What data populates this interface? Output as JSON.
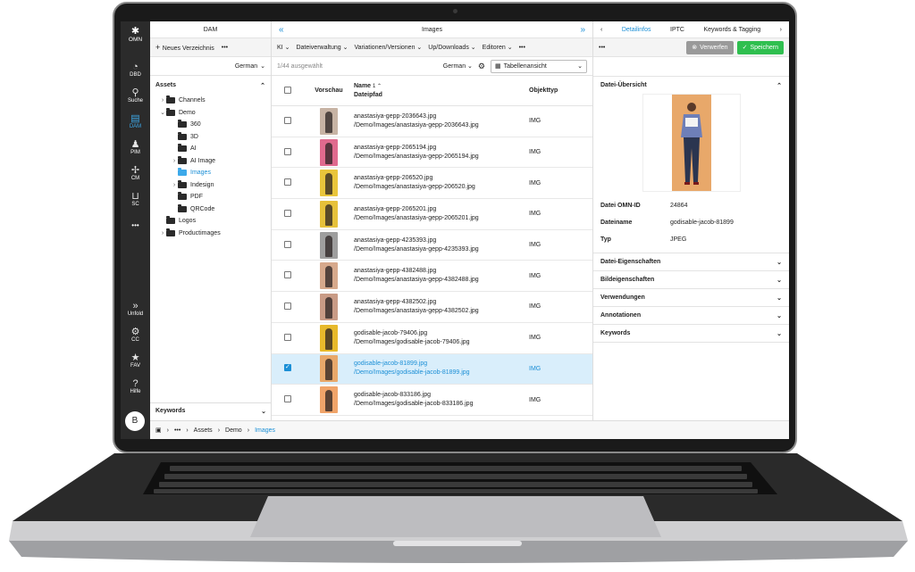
{
  "rail": {
    "logo": "OMN",
    "items": [
      {
        "label": "DBD",
        "icon": "dashboard-icon"
      },
      {
        "label": "Suche",
        "icon": "search-icon"
      },
      {
        "label": "DAM",
        "icon": "dam-icon"
      },
      {
        "label": "PIM",
        "icon": "pim-icon"
      },
      {
        "label": "CM",
        "icon": "cm-icon"
      },
      {
        "label": "SC",
        "icon": "cart-icon"
      },
      {
        "label": "Unfold",
        "icon": "unfold-icon"
      },
      {
        "label": "CC",
        "icon": "gear-icon"
      },
      {
        "label": "FAV",
        "icon": "star-icon"
      },
      {
        "label": "Hilfe",
        "icon": "help-icon"
      }
    ],
    "more": "•••",
    "avatar": "B"
  },
  "dam": {
    "title": "DAM",
    "new_dir": "Neues Verzeichnis",
    "more": "•••",
    "language": "German",
    "assets_label": "Assets",
    "tree": [
      {
        "label": "Channels",
        "chev": "›",
        "indent": 0
      },
      {
        "label": "Demo",
        "chev": "⌄",
        "indent": 0
      },
      {
        "label": "360",
        "chev": "",
        "indent": 1
      },
      {
        "label": "3D",
        "chev": "",
        "indent": 1
      },
      {
        "label": "AI",
        "chev": "",
        "indent": 1
      },
      {
        "label": "AI Image",
        "chev": "›",
        "indent": 1
      },
      {
        "label": "Images",
        "chev": "",
        "indent": 1
      },
      {
        "label": "Indesign",
        "chev": "›",
        "indent": 1
      },
      {
        "label": "PDF",
        "chev": "",
        "indent": 1
      },
      {
        "label": "QRCode",
        "chev": "",
        "indent": 1
      },
      {
        "label": "Logos",
        "chev": "",
        "indent": 0
      },
      {
        "label": "Productimages",
        "chev": "›",
        "indent": 0
      }
    ],
    "keywords": "Keywords"
  },
  "images": {
    "title": "Images",
    "menu": [
      "KI",
      "Dateiverwaltung",
      "Variationen/Versionen",
      "Up/Downloads",
      "Editoren"
    ],
    "more": "•••",
    "count": "1/44 ausgewählt",
    "language": "German",
    "view": "Tabellenansicht",
    "col_preview": "Vorschau",
    "col_name": "Name",
    "col_path": "Dateipfad",
    "sort": "1 ⌃",
    "col_type": "Objekttyp",
    "rows": [
      {
        "name": "anastasiya-gepp-2036643.jpg",
        "path": "/Demo/Images/anastasiya-gepp-2036643.jpg",
        "type": "IMG",
        "bg": "#c7b3a4",
        "checked": false
      },
      {
        "name": "anastasiya-gepp-2065194.jpg",
        "path": "/Demo/Images/anastasiya-gepp-2065194.jpg",
        "type": "IMG",
        "bg": "#e06a8e",
        "checked": false
      },
      {
        "name": "anastasiya-gepp-206520.jpg",
        "path": "/Demo/Images/anastasiya-gepp-206520.jpg",
        "type": "IMG",
        "bg": "#e9c53b",
        "checked": false
      },
      {
        "name": "anastasiya-gepp-2065201.jpg",
        "path": "/Demo/Images/anastasiya-gepp-2065201.jpg",
        "type": "IMG",
        "bg": "#e6c13a",
        "checked": false
      },
      {
        "name": "anastasiya-gepp-4235393.jpg",
        "path": "/Demo/Images/anastasiya-gepp-4235393.jpg",
        "type": "IMG",
        "bg": "#9e9e9e",
        "checked": false
      },
      {
        "name": "anastasiya-gepp-4382488.jpg",
        "path": "/Demo/Images/anastasiya-gepp-4382488.jpg",
        "type": "IMG",
        "bg": "#d7a98c",
        "checked": false
      },
      {
        "name": "anastasiya-gepp-4382502.jpg",
        "path": "/Demo/Images/anastasiya-gepp-4382502.jpg",
        "type": "IMG",
        "bg": "#c99b86",
        "checked": false
      },
      {
        "name": "godisable-jacob-79406.jpg",
        "path": "/Demo/Images/godisable-jacob-79406.jpg",
        "type": "IMG",
        "bg": "#e7b92b",
        "checked": false
      },
      {
        "name": "godisable-jacob-81899.jpg",
        "path": "/Demo/Images/godisable-jacob-81899.jpg",
        "type": "IMG",
        "bg": "#e8a86a",
        "checked": true
      },
      {
        "name": "godisable-jacob-833186.jpg",
        "path": "/Demo/Images/godisable-jacob-833186.jpg",
        "type": "IMG",
        "bg": "#f0a46a",
        "checked": false
      }
    ]
  },
  "detail": {
    "tabs": [
      "Detailinfos",
      "IPTC",
      "Keywords & Tagging"
    ],
    "more": "•••",
    "discard": "Verwerfen",
    "save": "Speichern",
    "overview": "Datei-Übersicht",
    "fields": [
      {
        "k": "Datei OMN-ID",
        "v": "24864"
      },
      {
        "k": "Dateiname",
        "v": "godisable-jacob-81899"
      },
      {
        "k": "Typ",
        "v": "JPEG"
      }
    ],
    "sections": [
      "Datei-Eigenschaften",
      "Bildeigenschaften",
      "Verwendungen",
      "Annotationen",
      "Keywords"
    ]
  },
  "breadcrumb": [
    "•••",
    "Assets",
    "Demo",
    "Images"
  ],
  "colors": {
    "accent": "#1b8fd6",
    "save": "#2fbf4f",
    "discard": "#9a9a9a",
    "rail": "#2b2b2b"
  }
}
